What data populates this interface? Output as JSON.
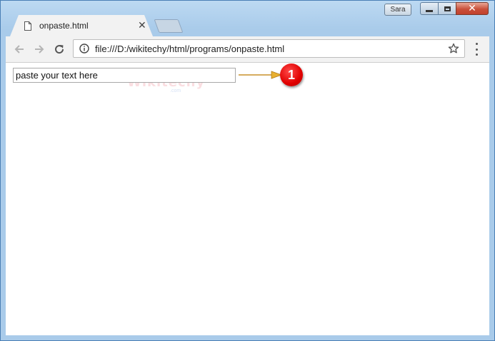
{
  "window": {
    "user_name": "Sara",
    "close_glyph": "✕"
  },
  "tab": {
    "title": "onpaste.html",
    "close_glyph": "✕",
    "icon": "document-icon"
  },
  "toolbar": {
    "url": "file:///D:/wikitechy/html/programs/onpaste.html",
    "icons": [
      "back-arrow-icon",
      "forward-arrow-icon",
      "reload-icon",
      "info-icon",
      "star-icon",
      "menu-icon"
    ]
  },
  "page": {
    "input_value": "paste your text here",
    "annotation_number": "1",
    "watermark_text": "Wikitechy",
    "watermark_sub": ".com"
  },
  "colors": {
    "marker": "#e00000",
    "arrow": "#d9a020"
  }
}
